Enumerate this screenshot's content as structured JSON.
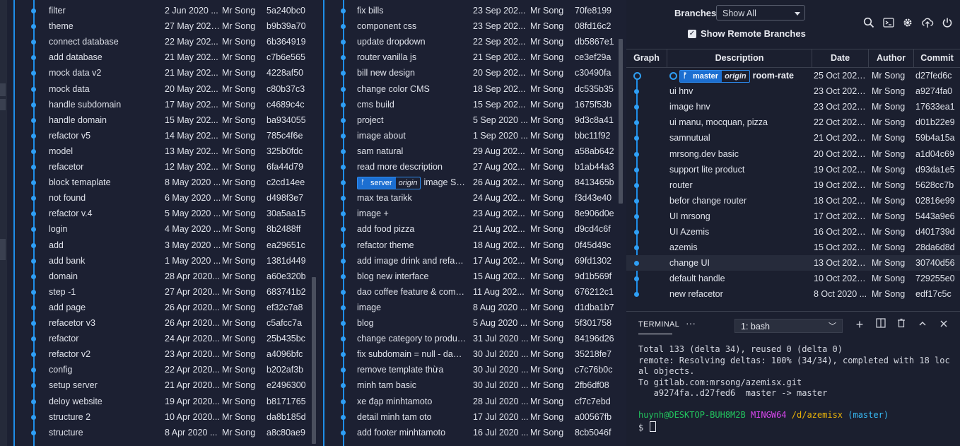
{
  "left_log": {
    "rows": [
      {
        "msg": "filter",
        "date": "2 Jun 2020 ...",
        "author": "Mr Song",
        "hash": "5a240bc0"
      },
      {
        "msg": "theme",
        "date": "27 May 2020...",
        "author": "Mr Song",
        "hash": "b9b39a70"
      },
      {
        "msg": "connect database",
        "date": "22 May 202...",
        "author": "Mr Song",
        "hash": "6b364919"
      },
      {
        "msg": "add database",
        "date": "21 May 202...",
        "author": "Mr Song",
        "hash": "c7b6e565"
      },
      {
        "msg": "mock data v2",
        "date": "21 May 202...",
        "author": "Mr Song",
        "hash": "4228af50"
      },
      {
        "msg": "mock data",
        "date": "20 May 202...",
        "author": "Mr Song",
        "hash": "c80b37c3"
      },
      {
        "msg": "handle subdomain",
        "date": "17 May 202...",
        "author": "Mr Song",
        "hash": "c4689c4c"
      },
      {
        "msg": "handle domain",
        "date": "15 May 202...",
        "author": "Mr Song",
        "hash": "ba934055"
      },
      {
        "msg": "refactor v5",
        "date": "14 May 202...",
        "author": "Mr Song",
        "hash": "785c4f6e"
      },
      {
        "msg": "model",
        "date": "13 May 202...",
        "author": "Mr Song",
        "hash": "325b0fdc"
      },
      {
        "msg": "refacetor",
        "date": "12 May 202...",
        "author": "Mr Song",
        "hash": "6fa44d79"
      },
      {
        "msg": "block temaplate",
        "date": "8 May 2020 ...",
        "author": "Mr Song",
        "hash": "c2cd14ee"
      },
      {
        "msg": "not found",
        "date": "6 May 2020 ...",
        "author": "Mr Song",
        "hash": "d498f3e7"
      },
      {
        "msg": "refactor v.4",
        "date": "5 May 2020 ...",
        "author": "Mr Song",
        "hash": "30a5aa15"
      },
      {
        "msg": "login",
        "date": "4 May 2020 ...",
        "author": "Mr Song",
        "hash": "8b2488ff"
      },
      {
        "msg": "add",
        "date": "3 May 2020 ...",
        "author": "Mr Song",
        "hash": "ea29651c"
      },
      {
        "msg": "add bank",
        "date": "1 May 2020 ...",
        "author": "Mr Song",
        "hash": "1381d449"
      },
      {
        "msg": "domain",
        "date": "28 Apr 2020...",
        "author": "Mr Song",
        "hash": "a60e320b"
      },
      {
        "msg": "step -1",
        "date": "27 Apr 2020...",
        "author": "Mr Song",
        "hash": "683741b2"
      },
      {
        "msg": "add page",
        "date": "26 Apr 2020...",
        "author": "Mr Song",
        "hash": "ef32c7a8"
      },
      {
        "msg": "refacetor v3",
        "date": "26 Apr 2020...",
        "author": "Mr Song",
        "hash": "c5afcc7a"
      },
      {
        "msg": "refactor",
        "date": "24 Apr 2020...",
        "author": "Mr Song",
        "hash": "25b435bc"
      },
      {
        "msg": "refactor v2",
        "date": "23 Apr 2020...",
        "author": "Mr Song",
        "hash": "a4096bfc"
      },
      {
        "msg": "config",
        "date": "22 Apr 2020...",
        "author": "Mr Song",
        "hash": "b202af3b"
      },
      {
        "msg": "setup server",
        "date": "21 Apr 2020...",
        "author": "Mr Song",
        "hash": "e2496300"
      },
      {
        "msg": "deloy website",
        "date": "19 Apr 2020...",
        "author": "Mr Song",
        "hash": "b8171765"
      },
      {
        "msg": "structure 2",
        "date": "10 Apr 2020...",
        "author": "Mr Song",
        "hash": "da8b185d"
      },
      {
        "msg": "structure",
        "date": "8 Apr 2020 ...",
        "author": "Mr Song",
        "hash": "a8c80ae9"
      }
    ]
  },
  "middle_log": {
    "rows": [
      {
        "msg": "fix bills",
        "date": "23 Sep 202...",
        "author": "Mr Song",
        "hash": "70fe8199"
      },
      {
        "msg": "component css",
        "date": "23 Sep 202...",
        "author": "Mr Song",
        "hash": "08fd16c2"
      },
      {
        "msg": "update dropdown",
        "date": "22 Sep 202...",
        "author": "Mr Song",
        "hash": "db5867e1"
      },
      {
        "msg": "router vanilla js",
        "date": "21 Sep 202...",
        "author": "Mr Song",
        "hash": "ce3ef29a"
      },
      {
        "msg": "bill new design",
        "date": "20 Sep 202...",
        "author": "Mr Song",
        "hash": "c30490fa"
      },
      {
        "msg": "change color CMS",
        "date": "18 Sep 202...",
        "author": "Mr Song",
        "hash": "dc535b35"
      },
      {
        "msg": "cms build",
        "date": "15 Sep 202...",
        "author": "Mr Song",
        "hash": "1675f53b"
      },
      {
        "msg": "project",
        "date": "5 Sep 2020 ...",
        "author": "Mr Song",
        "hash": "9d3c8a41"
      },
      {
        "msg": "image about",
        "date": "1 Sep 2020 ...",
        "author": "Mr Song",
        "hash": "bbc11f92"
      },
      {
        "msg": "sam natural",
        "date": "29 Aug 202...",
        "author": "Mr Song",
        "hash": "a58ab642"
      },
      {
        "msg": "read more description",
        "date": "27 Aug 202...",
        "author": "Mr Song",
        "hash": "b1ab44a3"
      },
      {
        "msg": "image Sa...",
        "date": "26 Aug 202...",
        "author": "Mr Song",
        "hash": "8413465b",
        "badge": {
          "name": "server",
          "origin": "origin"
        }
      },
      {
        "msg": "max tea tarikk",
        "date": "24 Aug 202...",
        "author": "Mr Song",
        "hash": "f3d43e40"
      },
      {
        "msg": "image +",
        "date": "23 Aug 202...",
        "author": "Mr Song",
        "hash": "8e906d0e"
      },
      {
        "msg": "add food pizza",
        "date": "21 Aug 202...",
        "author": "Mr Song",
        "hash": "d9cd4c6f"
      },
      {
        "msg": "refactor theme",
        "date": "18 Aug 202...",
        "author": "Mr Song",
        "hash": "0f45d49c"
      },
      {
        "msg": "add image drink and refact...",
        "date": "17 Aug 202...",
        "author": "Mr Song",
        "hash": "69fd1302"
      },
      {
        "msg": "blog new interface",
        "date": "15 Aug 202...",
        "author": "Mr Song",
        "hash": "9d1b569f"
      },
      {
        "msg": "dao coffee feature & comm...",
        "date": "11 Aug 202...",
        "author": "Mr Song",
        "hash": "676212c1"
      },
      {
        "msg": "image",
        "date": "8 Aug 2020 ...",
        "author": "Mr Song",
        "hash": "d1dba1b7"
      },
      {
        "msg": "blog",
        "date": "5 Aug 2020 ...",
        "author": "Mr Song",
        "hash": "5f301758"
      },
      {
        "msg": "change category to product...",
        "date": "31 Jul 2020 ...",
        "author": "Mr Song",
        "hash": "84196d26"
      },
      {
        "msg": "fix subdomain = null - dana...",
        "date": "30 Jul 2020 ...",
        "author": "Mr Song",
        "hash": "35218fe7"
      },
      {
        "msg": "remove template thừa",
        "date": "30 Jul 2020 ...",
        "author": "Mr Song",
        "hash": "c7c76b0c"
      },
      {
        "msg": "minh tam basic",
        "date": "30 Jul 2020 ...",
        "author": "Mr Song",
        "hash": "2fb6df08"
      },
      {
        "msg": "xe đạp minhtamoto",
        "date": "28 Jul 2020 ...",
        "author": "Mr Song",
        "hash": "cf7c7ebd"
      },
      {
        "msg": "detail minh tam oto",
        "date": "17 Jul 2020 ...",
        "author": "Mr Song",
        "hash": "a00567fb"
      },
      {
        "msg": "add footer minhtamoto",
        "date": "16 Jul 2020 ...",
        "author": "Mr Song",
        "hash": "8cb5046f"
      }
    ]
  },
  "right_panel": {
    "branches_label": "Branches:",
    "branches_value": "Show All",
    "show_remote_label": "Show Remote Branches",
    "show_remote_checked": true,
    "toolbar_icons": [
      "search-icon",
      "terminal-icon",
      "gear-icon",
      "cloud-upload-icon",
      "power-icon"
    ],
    "columns": {
      "graph": "Graph",
      "description": "Description",
      "date": "Date",
      "author": "Author",
      "commit": "Commit"
    },
    "rows": [
      {
        "msg": "room-rate",
        "date": "25 Oct 2020...",
        "author": "Mr Song",
        "hash": "d27fed6c",
        "badge": {
          "name": "master",
          "origin": "origin"
        },
        "bold": true
      },
      {
        "msg": "ui hnv",
        "date": "23 Oct 2020...",
        "author": "Mr Song",
        "hash": "a9274fa0"
      },
      {
        "msg": "image hnv",
        "date": "23 Oct 2020...",
        "author": "Mr Song",
        "hash": "17633ea1"
      },
      {
        "msg": "ui manu, mocquan, pizza",
        "date": "22 Oct 2020...",
        "author": "Mr Song",
        "hash": "d01b22e9"
      },
      {
        "msg": "samnutual",
        "date": "21 Oct 2020...",
        "author": "Mr Song",
        "hash": "59b4a15a"
      },
      {
        "msg": "mrsong.dev basic",
        "date": "20 Oct 2020...",
        "author": "Mr Song",
        "hash": "a1d04c69"
      },
      {
        "msg": "support lite product",
        "date": "19 Oct 2020...",
        "author": "Mr Song",
        "hash": "d93da1e5"
      },
      {
        "msg": "router",
        "date": "19 Oct 2020...",
        "author": "Mr Song",
        "hash": "5628cc7b"
      },
      {
        "msg": "befor change router",
        "date": "18 Oct 2020...",
        "author": "Mr Song",
        "hash": "02816e99"
      },
      {
        "msg": "UI mrsong",
        "date": "17 Oct 2020...",
        "author": "Mr Song",
        "hash": "5443a9e6"
      },
      {
        "msg": "UI Azemis",
        "date": "16 Oct 2020...",
        "author": "Mr Song",
        "hash": "d401739d"
      },
      {
        "msg": "azemis",
        "date": "15 Oct 2020...",
        "author": "Mr Song",
        "hash": "28da6d8d"
      },
      {
        "msg": "change UI",
        "date": "13 Oct 2020...",
        "author": "Mr Song",
        "hash": "30740d56",
        "highlight": true
      },
      {
        "msg": "default handle",
        "date": "10 Oct 2020...",
        "author": "Mr Song",
        "hash": "729255e0"
      },
      {
        "msg": "new refacetor",
        "date": "8 Oct 2020 ...",
        "author": "Mr Song",
        "hash": "edf17c5c"
      }
    ]
  },
  "terminal": {
    "tab_label": "TERMINAL",
    "more_label": "···",
    "shell_select": "1: bash",
    "action_icons": [
      "plus-icon",
      "split-icon",
      "trash-icon",
      "chevron-up-icon",
      "close-icon"
    ],
    "lines": [
      "Total 133 (delta 34), reused 0 (delta 0)",
      "remote: Resolving deltas: 100% (34/34), completed with 18 loc",
      "al objects.",
      "To gitlab.com:mrsong/azemisx.git",
      "   a9274fa..d27fed6  master -> master",
      ""
    ],
    "prompt": {
      "user": "huynh@DESKTOP-BUH8M2B",
      "host": "MINGW64",
      "path": "/d/azemisx",
      "branch": "(master)",
      "symbol": "$"
    }
  }
}
